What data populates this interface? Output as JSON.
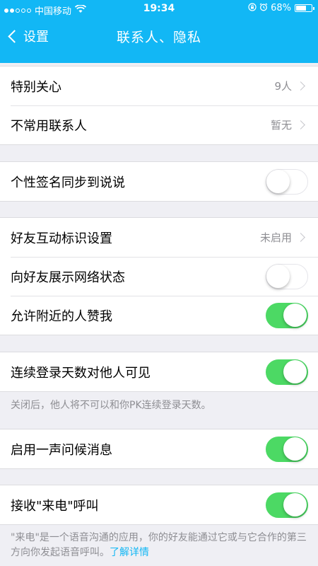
{
  "status_bar": {
    "signal_dots": [
      true,
      true,
      false,
      false,
      false
    ],
    "carrier": "中国移动",
    "time": "19:34",
    "battery_percent": "68%",
    "battery_level": 0.68
  },
  "nav": {
    "back_label": "设置",
    "title": "联系人、隐私"
  },
  "groups": {
    "group1": {
      "special_care": {
        "label": "特别关心",
        "value": "9人"
      },
      "infrequent_contacts": {
        "label": "不常用联系人",
        "value": "暂无"
      }
    },
    "group2": {
      "signature_sync": {
        "label": "个性签名同步到说说",
        "on": false
      }
    },
    "group3": {
      "friend_interaction": {
        "label": "好友互动标识设置",
        "value": "未启用"
      },
      "network_status": {
        "label": "向好友展示网络状态",
        "on": false
      },
      "nearby_likes": {
        "label": "允许附近的人赞我",
        "on": true
      }
    },
    "group4": {
      "login_days": {
        "label": "连续登录天数对他人可见",
        "on": true
      },
      "note": "关闭后，他人将不可以和你PK连续登录天数。"
    },
    "group5": {
      "greeting": {
        "label": "启用一声问候消息",
        "on": true
      }
    },
    "group6": {
      "incoming_call": {
        "label": "接收\"来电\"呼叫",
        "on": true
      },
      "note": "\"来电\"是一个语音沟通的应用，你的好友能通过它或与它合作的第三方向你发起语音呼叫。",
      "note_link": "了解详情"
    }
  },
  "colors": {
    "header_bg": "#12b7f5",
    "toggle_on": "#4cd964",
    "link": "#12b7f5"
  }
}
